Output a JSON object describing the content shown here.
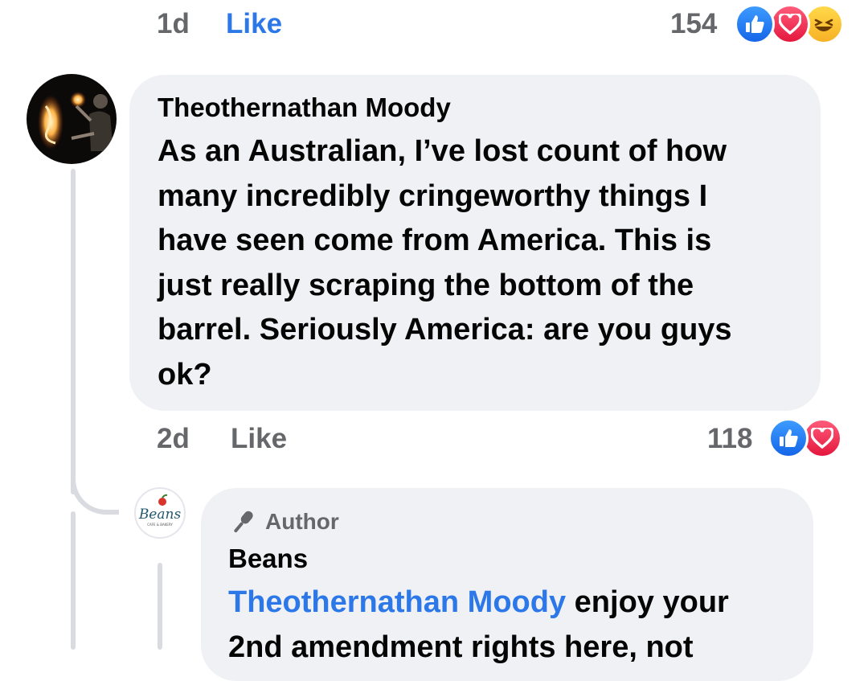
{
  "top_row": {
    "age": "1d",
    "like_label": "Like",
    "reaction_count": "154",
    "reaction_icons": [
      "like-icon",
      "love-icon",
      "haha-icon"
    ]
  },
  "comment": {
    "author": "Theothernathan Moody",
    "lines": [
      "As an Australian, I’ve lost count of how",
      "many incredibly cringeworthy things I",
      "have seen come from America. This is",
      "just really scraping the bottom of the",
      "barrel. Seriously America: are you guys",
      "ok?"
    ],
    "age": "2d",
    "like_label": "Like",
    "reaction_count": "118",
    "reaction_icons": [
      "like-icon",
      "love-icon"
    ]
  },
  "reply": {
    "badge_label": "Author",
    "author": "Beans",
    "mention": "Theothernathan Moody",
    "text_after_mention": " enjoy your",
    "next_line": "2nd amendment rights here, not",
    "avatar_logo_text": "Beans",
    "avatar_logo_subtext": "CAFE & BAKERY"
  },
  "colors": {
    "accent_blue": "#2d78e8",
    "meta_gray": "#65676b",
    "bubble_bg": "#f0f1f4"
  }
}
